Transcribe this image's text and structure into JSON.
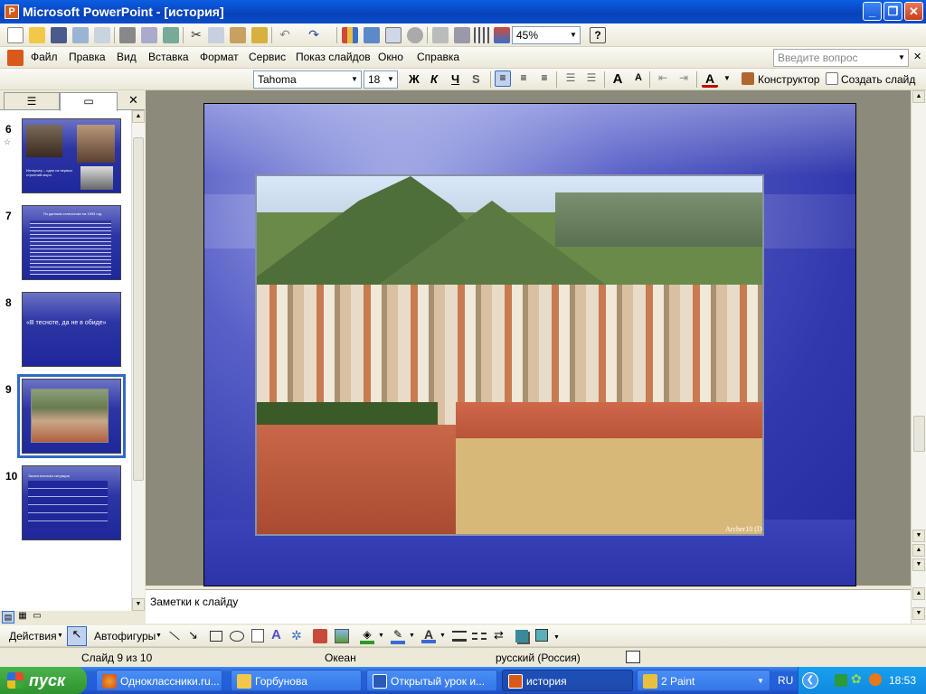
{
  "window": {
    "title": "Microsoft PowerPoint - [история]",
    "app_icon": "powerpoint-icon"
  },
  "toolbar": {
    "zoom": "45%"
  },
  "menu": {
    "items": [
      "Файл",
      "Правка",
      "Вид",
      "Вставка",
      "Формат",
      "Сервис",
      "Показ слайдов",
      "Окно",
      "Справка"
    ],
    "help_placeholder": "Введите вопрос"
  },
  "formatting": {
    "font": "Tahoma",
    "size": "18",
    "bold": "Ж",
    "italic": "К",
    "underline": "Ч",
    "shadow": "S",
    "designer": "Конструктор",
    "new_slide": "Создать слайд"
  },
  "slides": [
    {
      "num": "6",
      "caption": "Интерьер – одно из первых строений моря"
    },
    {
      "num": "7",
      "caption": "По данным статистики на 1993 год"
    },
    {
      "num": "8",
      "caption": "«В тесноте, да не в обиде»"
    },
    {
      "num": "9",
      "caption": ""
    },
    {
      "num": "10",
      "caption": "Экологическая ситуация"
    }
  ],
  "slide": {
    "watermark": "Archer10 (D"
  },
  "notes": {
    "placeholder": "Заметки к слайду"
  },
  "drawing": {
    "actions": "Действия",
    "autoshapes": "Автофигуры"
  },
  "status": {
    "slide": "Слайд 9 из 10",
    "design": "Океан",
    "language": "русский (Россия)"
  },
  "taskbar": {
    "start": "пуск",
    "tasks": [
      {
        "label": "Одноклассники.ru...",
        "icon": "firefox-icon"
      },
      {
        "label": "Горбунова",
        "icon": "folder-icon"
      },
      {
        "label": "Открытый урок и...",
        "icon": "word-icon"
      },
      {
        "label": "история",
        "icon": "powerpoint-icon"
      },
      {
        "label": "2 Paint",
        "icon": "paint-icon"
      }
    ],
    "lang": "RU",
    "clock": "18:53"
  }
}
